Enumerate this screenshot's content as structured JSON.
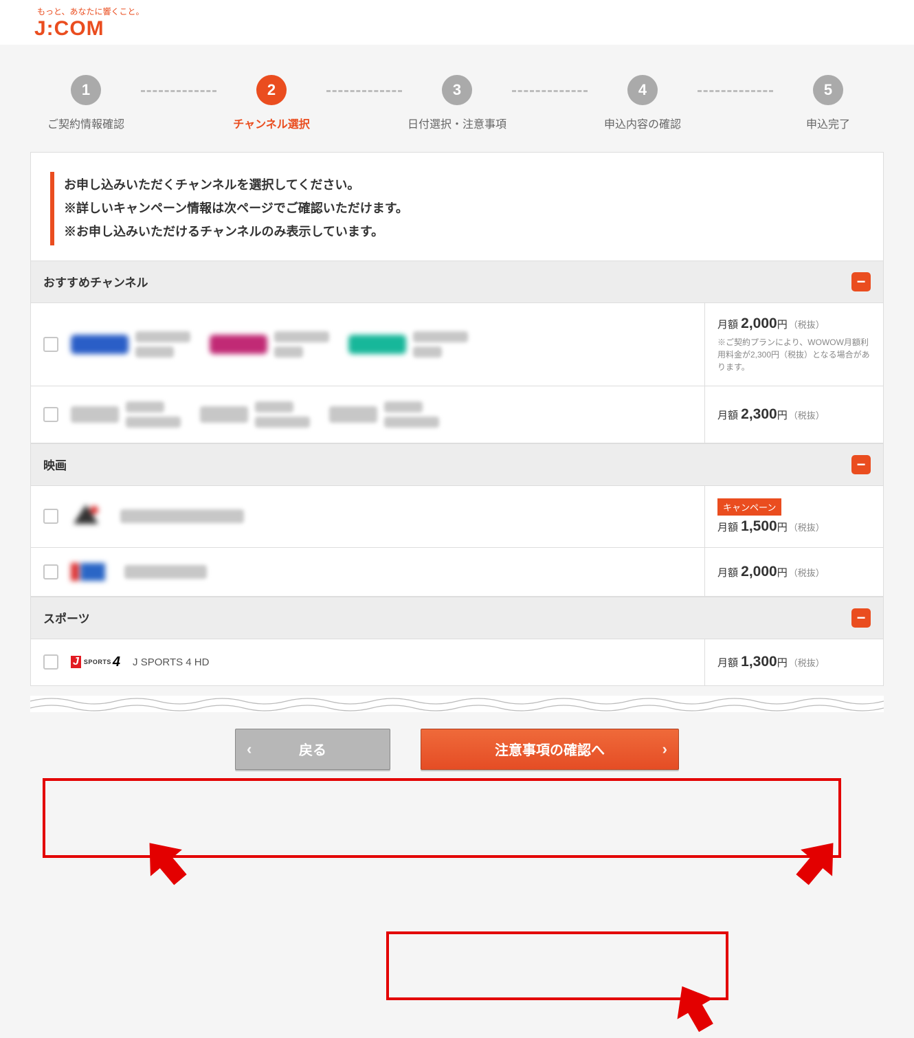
{
  "tagline": "もっと、あなたに響くこと。",
  "brand": "J:COM",
  "steps": [
    {
      "n": "1",
      "label": "ご契約情報確認"
    },
    {
      "n": "2",
      "label": "チャンネル選択"
    },
    {
      "n": "3",
      "label": "日付選択・注意事項"
    },
    {
      "n": "4",
      "label": "申込内容の確認"
    },
    {
      "n": "5",
      "label": "申込完了"
    }
  ],
  "activeStep": 1,
  "notice": {
    "l1": "お申し込みいただくチャンネルを選択してください。",
    "l2": "※詳しいキャンペーン情報は次ページでご確認いただけます。",
    "l3": "※お申し込みいただけるチャンネルのみ表示しています。"
  },
  "sections": {
    "recommended": {
      "title": "おすすめチャンネル"
    },
    "movie": {
      "title": "映画"
    },
    "sports": {
      "title": "スポーツ"
    }
  },
  "prices": {
    "tax": "（税抜）",
    "prefix": "月額 ",
    "yen": "円"
  },
  "rows": {
    "r1": {
      "price": "2,000",
      "note": "※ご契約プランにより、WOWOW月額利用料金が2,300円（税抜）となる場合があります。"
    },
    "r2": {
      "price": "2,300"
    },
    "r3": {
      "price": "1,500",
      "badge": "キャンペーン"
    },
    "r4": {
      "price": "2,000"
    },
    "r5": {
      "price": "1,300",
      "name": "J SPORTS 4 HD"
    }
  },
  "collapseGlyph": "−",
  "jsports": {
    "j": "J",
    "s": "SPORTS",
    "n": "4"
  },
  "buttons": {
    "back": "戻る",
    "next": "注意事項の確認へ"
  },
  "colors": {
    "accent": "#ea4d1f",
    "highlight": "#e30000"
  }
}
